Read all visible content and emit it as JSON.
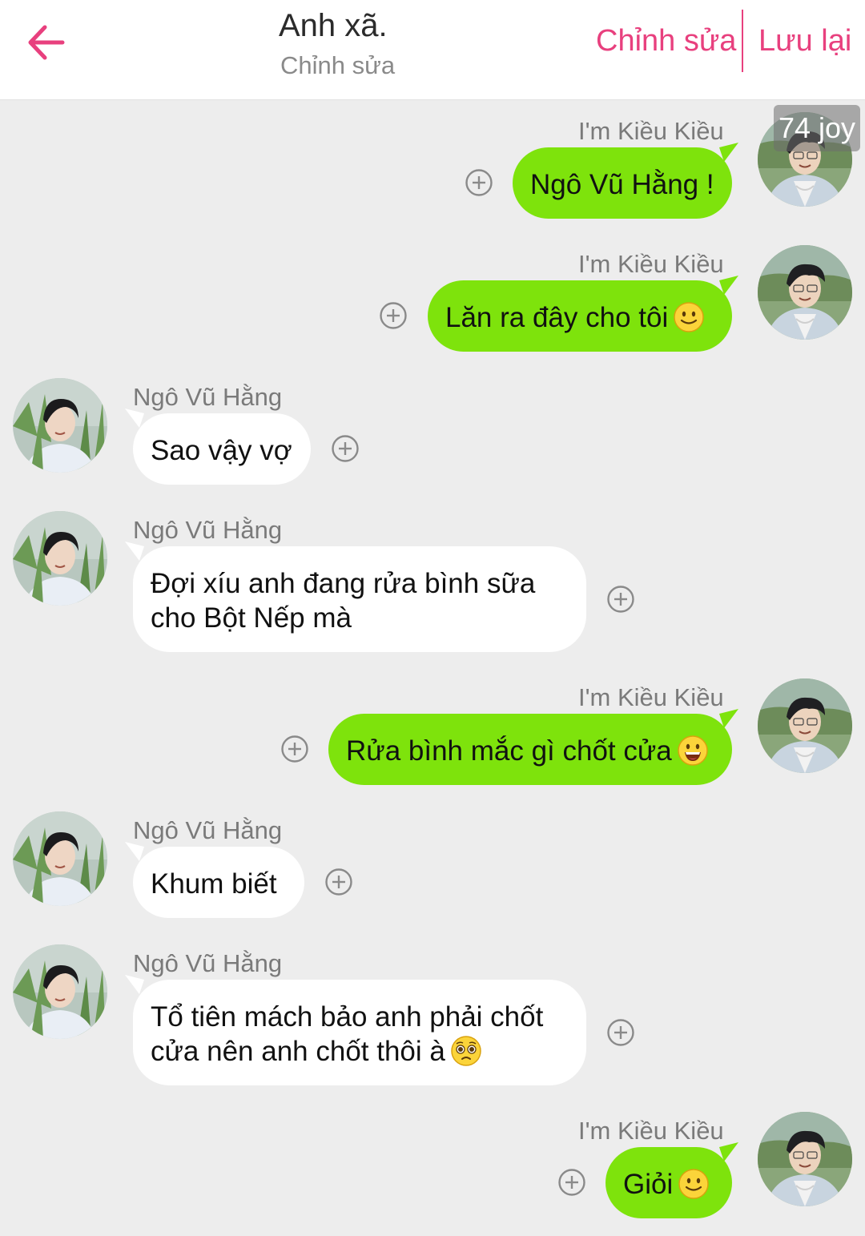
{
  "header": {
    "title": "Anh xã.",
    "subtitle": "Chỉnh sửa",
    "edit_label": "Chỉnh sửa",
    "save_label": "Lưu lại"
  },
  "colors": {
    "accent": "#e8407e",
    "me_bubble": "#7ee30c",
    "them_bubble": "#ffffff",
    "background": "#ededed"
  },
  "badge": "74 joy",
  "messages": [
    {
      "sender": "I'm Kiều Kiều",
      "text": "Ngô Vũ Hằng !",
      "emoji": ""
    },
    {
      "sender": "I'm Kiều Kiều",
      "text": "Lăn ra đây cho tôi",
      "emoji": "slight-smile"
    },
    {
      "sender": "Ngô Vũ Hằng",
      "text": "Sao vậy vợ",
      "emoji": ""
    },
    {
      "sender": "Ngô Vũ Hằng",
      "line1": "Đợi xíu anh đang rửa bình sữa",
      "line2": "cho Bột Nếp mà",
      "emoji": ""
    },
    {
      "sender": "I'm Kiều Kiều",
      "text": "Rửa bình mắc gì chốt cửa",
      "emoji": "grin"
    },
    {
      "sender": "Ngô Vũ Hằng",
      "text": "Khum biết",
      "emoji": ""
    },
    {
      "sender": "Ngô Vũ Hằng",
      "line1": "Tổ tiên mách bảo anh phải chốt",
      "line2": "cửa nên anh chốt thôi à",
      "emoji": "pleading"
    },
    {
      "sender": "I'm Kiều Kiều",
      "text": "Giỏi",
      "emoji": "slight-smile"
    }
  ]
}
